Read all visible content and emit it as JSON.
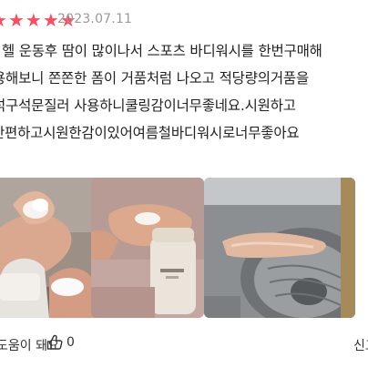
{
  "review": {
    "rating": 5,
    "star_color": "#fd4c5d",
    "date": "2023.07.11",
    "lines": [
      "헬 운동후 땀이 많이나서 스포츠 바디워시를 한번구매해",
      "용해보니 쫀쫀한 폼이 거품처럼 나오고 적당량의거품을",
      "석구석문질러 사용하니쿨링감이너무좋네요.시원하고",
      "간편하고시원한감이있어여름철바디워시로너무좋아요"
    ]
  },
  "photos": [
    {
      "name": "photo-1",
      "icon": "foam-hand-photo"
    },
    {
      "name": "photo-2",
      "icon": "bottle-hand-photo"
    },
    {
      "name": "photo-3",
      "icon": "sink-hand-photo"
    }
  ],
  "footer": {
    "helpful_label": "도움이 돼요",
    "like_count": "0",
    "report_label": "신고"
  }
}
